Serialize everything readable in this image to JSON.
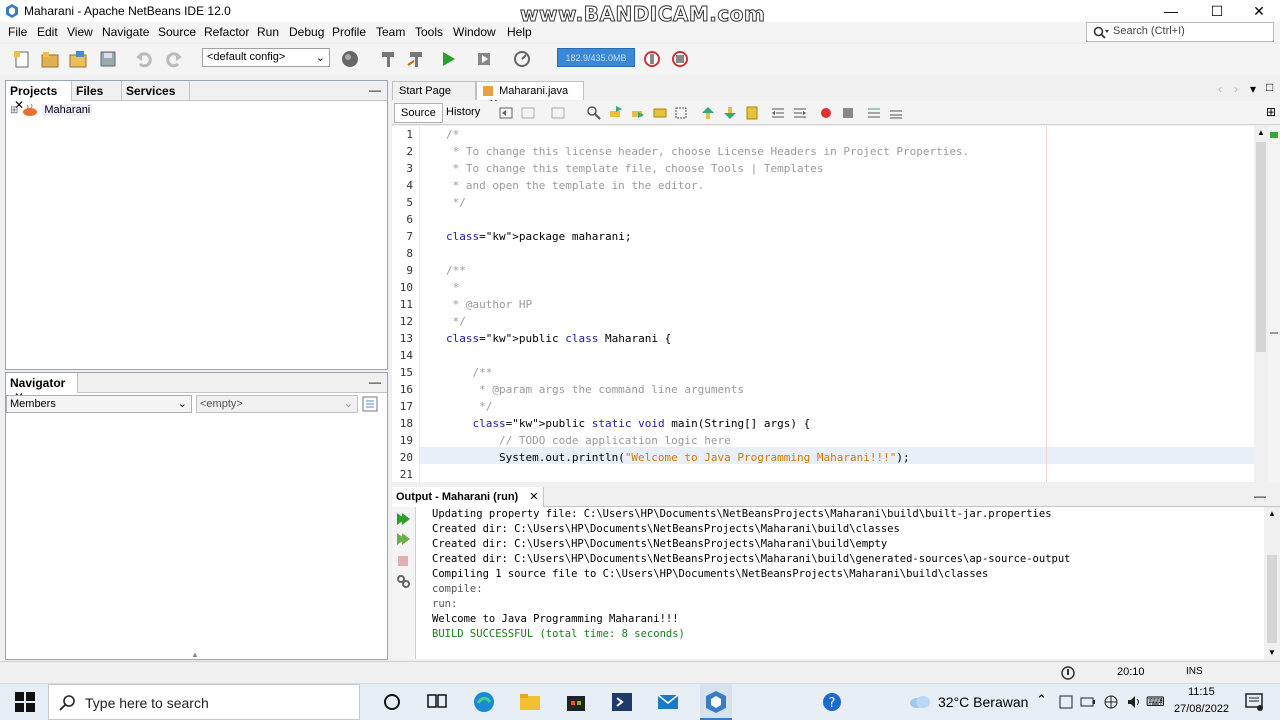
{
  "window": {
    "title": "Maharani - Apache NetBeans IDE 12.0",
    "watermark": "www.BANDICAM.com",
    "minimize": "—",
    "maximize": "☐",
    "close": "✕"
  },
  "menu": [
    "File",
    "Edit",
    "View",
    "Navigate",
    "Source",
    "Refactor",
    "Run",
    "Debug",
    "Profile",
    "Team",
    "Tools",
    "Window",
    "Help"
  ],
  "search": {
    "placeholder": "Search (Ctrl+I)"
  },
  "toolbar": {
    "config": "<default config>",
    "memory": "182.9/435.0MB"
  },
  "projects_panel": {
    "tabs": [
      "Projects",
      "Files",
      "Services"
    ],
    "tab_close": "✕",
    "minimize": "—",
    "tree": [
      {
        "expander": "⊞",
        "label": "Maharani"
      }
    ]
  },
  "navigator_panel": {
    "title": "Navigator",
    "close": "✕",
    "minimize": "—",
    "members": "Members",
    "empty": "<empty>"
  },
  "editor": {
    "tabs": [
      {
        "label": "Start Page",
        "closable": false
      },
      {
        "label": "Maharani.java",
        "closable": true
      }
    ],
    "tab_close": "✕",
    "subtabs": [
      "Source",
      "History"
    ],
    "line_numbers": [
      "1",
      "2",
      "3",
      "4",
      "5",
      "6",
      "7",
      "8",
      "9",
      "10",
      "11",
      "12",
      "13",
      "14",
      "15",
      "16",
      "17",
      "18",
      "19",
      "20",
      "21"
    ],
    "lines": [
      "/*",
      " * To change this license header, choose License Headers in Project Properties.",
      " * To change this template file, choose Tools | Templates",
      " * and open the template in the editor.",
      " */",
      "",
      "package maharani;",
      "",
      "/**",
      " *",
      " * @author HP",
      " */",
      "public class Maharani {",
      "",
      "    /**",
      "     * @param args the command line arguments",
      "     */",
      "    public static void main(String[] args) {",
      "        // TODO code application logic here",
      "        System.out.println(\"Welcome to Java Programming Maharani!!!\");",
      ""
    ],
    "line20_prefix": "        System.out.println(",
    "line20_string": "\"Welcome to Java Programming Maharani!!!\"",
    "line20_suffix": ");"
  },
  "output": {
    "title": "Output - Maharani (run)",
    "close": "✕",
    "minimize": "—",
    "lines": [
      "Updating property file: C:\\Users\\HP\\Documents\\NetBeansProjects\\Maharani\\build\\built-jar.properties",
      "Created dir: C:\\Users\\HP\\Documents\\NetBeansProjects\\Maharani\\build\\classes",
      "Created dir: C:\\Users\\HP\\Documents\\NetBeansProjects\\Maharani\\build\\empty",
      "Created dir: C:\\Users\\HP\\Documents\\NetBeansProjects\\Maharani\\build\\generated-sources\\ap-source-output",
      "Compiling 1 source file to C:\\Users\\HP\\Documents\\NetBeansProjects\\Maharani\\build\\classes",
      "compile:",
      "run:",
      "Welcome to Java Programming Maharani!!!",
      "BUILD SUCCESSFUL (total time: 8 seconds)"
    ]
  },
  "statusbar": {
    "position": "20:10",
    "mode": "INS"
  },
  "taskbar": {
    "search_placeholder": "Type here to search",
    "weather": "32°C  Berawan",
    "time": "11:15",
    "date": "27/08/2022"
  },
  "colors": {
    "keyword": "#1a1aa6",
    "comment": "#9a9a9a",
    "string": "#ce7b00",
    "memory_bar": "#3a88d8"
  }
}
